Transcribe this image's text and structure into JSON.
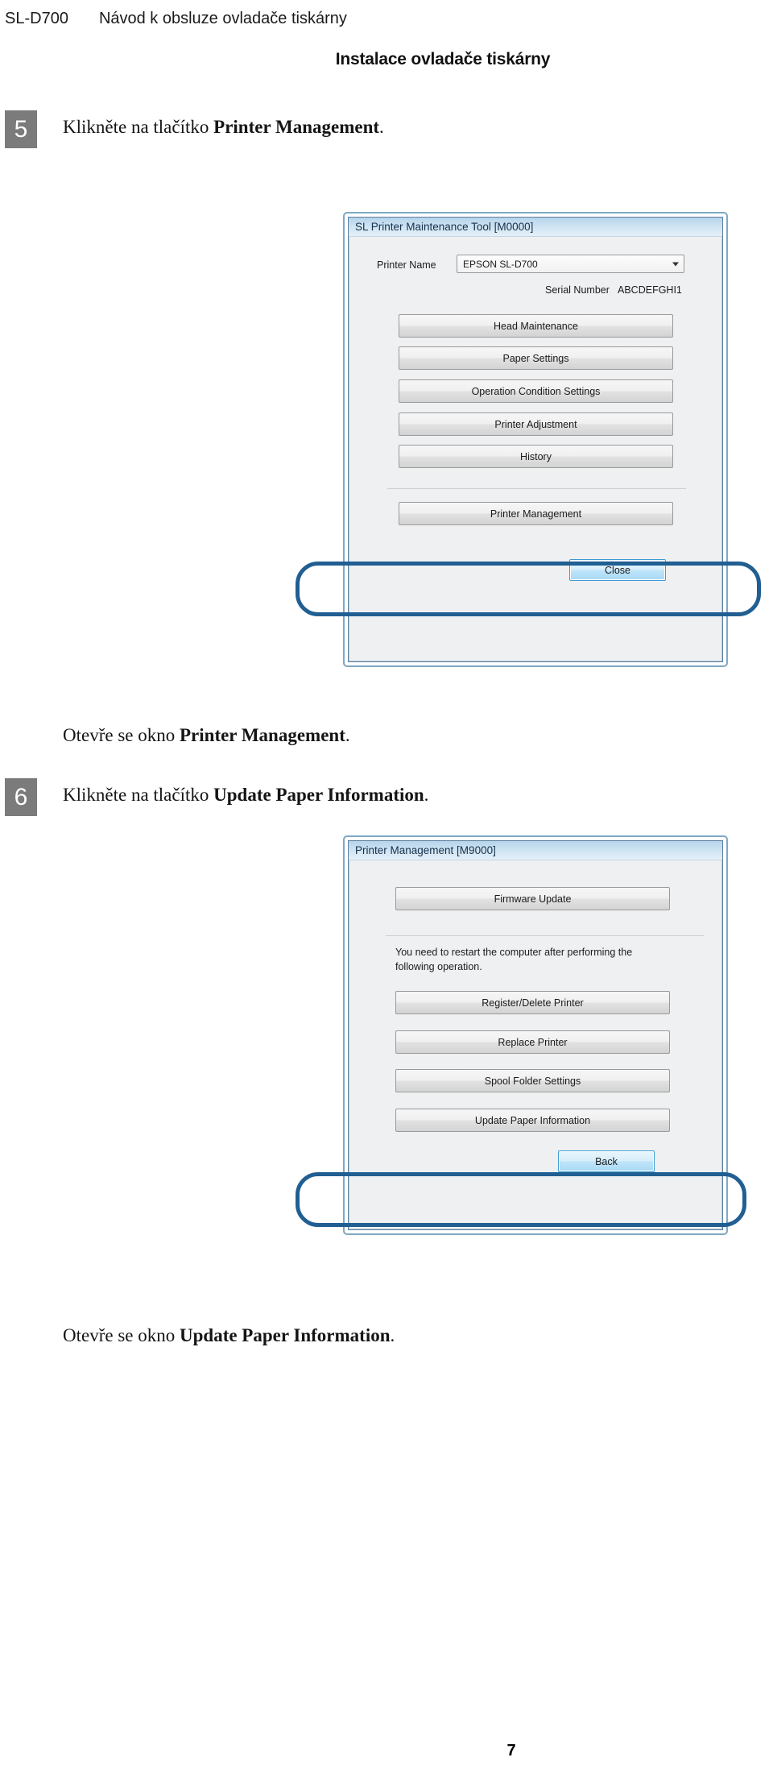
{
  "header": {
    "model": "SL-D700",
    "manual_title": "Návod k obsluze ovladače tiskárny"
  },
  "section_title": "Instalace ovladače tiskárny",
  "page_number": "7",
  "steps": [
    {
      "number": "5",
      "text_plain": "Klikněte na tlačítko ",
      "text_bold": "Printer Management",
      "text_tail": "."
    },
    {
      "number": "6",
      "text_plain": "Klikněte na tlačítko ",
      "text_bold": "Update Paper Information",
      "text_tail": "."
    }
  ],
  "notes": [
    {
      "text_plain": "Otevře se okno ",
      "text_bold": "Printer Management",
      "text_tail": "."
    },
    {
      "text_plain": "Otevře se okno ",
      "text_bold": "Update Paper Information",
      "text_tail": "."
    }
  ],
  "dialog1": {
    "title": "SL Printer Maintenance Tool [M0000]",
    "printer_name_label": "Printer Name",
    "printer_name_value": "EPSON SL-D700",
    "serial_number_label": "Serial Number",
    "serial_number_value": "ABCDEFGHI1",
    "buttons": [
      "Head Maintenance",
      "Paper Settings",
      "Operation Condition Settings",
      "Printer Adjustment",
      "History"
    ],
    "highlighted_button": "Printer Management",
    "close_button": "Close"
  },
  "dialog2": {
    "title": "Printer Management [M9000]",
    "firmware_button": "Firmware Update",
    "notice": "You need to restart the computer after performing the following operation.",
    "buttons": [
      "Register/Delete Printer",
      "Replace Printer",
      "Spool Folder Settings"
    ],
    "highlighted_button": "Update Paper Information",
    "back_button": "Back"
  },
  "colors": {
    "callout_blue": "#215f93",
    "titlebar_blue": "#b5d4ea",
    "badge_grey": "#7b7b7b",
    "dialog_bg": "#eff0f1"
  }
}
